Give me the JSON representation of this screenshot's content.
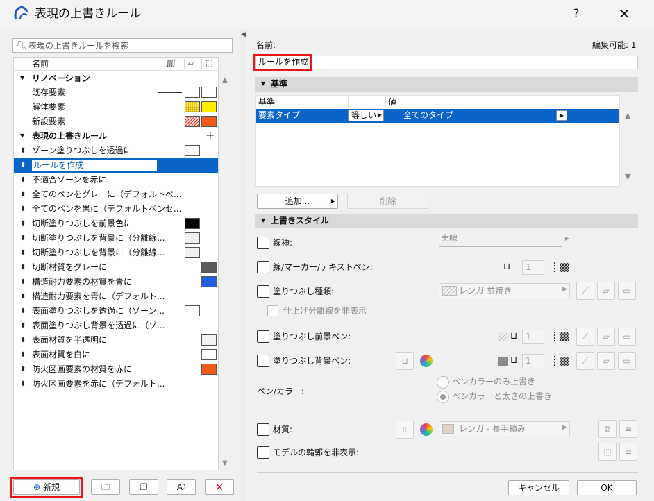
{
  "window": {
    "title": "表現の上書きルール",
    "help": "?",
    "close": "✕"
  },
  "search": {
    "placeholder": "表現の上書きルールを検索"
  },
  "list": {
    "header": {
      "name": "名前"
    },
    "groups": [
      {
        "label": "リノベーション",
        "items": [
          {
            "label": "既存要素"
          },
          {
            "label": "解体要素"
          },
          {
            "label": "新設要素"
          }
        ]
      },
      {
        "label": "表現の上書きルール",
        "add": "+",
        "items": [
          {
            "label": "ゾーン塗りつぶしを透過に"
          },
          {
            "label": "ルールを作成",
            "selected": true
          },
          {
            "label": "不適合ゾーンを赤に"
          },
          {
            "label": "全てのペンをグレーに（デフォルトペ..."
          },
          {
            "label": "全てのペンを黒に（デフォルトペンセ..."
          },
          {
            "label": "切断塗りつぶしを前景色に"
          },
          {
            "label": "切断塗りつぶしを背景に（分離線..."
          },
          {
            "label": "切断塗りつぶしを背景に（分離線..."
          },
          {
            "label": "切断材質をグレーに"
          },
          {
            "label": "構造耐力要素の材質を青に"
          },
          {
            "label": "構造耐力要素を青に（デフォルト..."
          },
          {
            "label": "表面塗りつぶしを透過に（ゾーン..."
          },
          {
            "label": "表面塗りつぶし背景を透過に（ゾ..."
          },
          {
            "label": "表面材質を半透明に"
          },
          {
            "label": "表面材質を白に"
          },
          {
            "label": "防火区画要素の材質を赤に"
          },
          {
            "label": "防火区画要素を赤に（デフォルト..."
          }
        ]
      }
    ]
  },
  "bottom_buttons": {
    "new": "新規"
  },
  "colors": {
    "selection": "#0a64c8",
    "highlight_box": "#e8141a",
    "yellow": "#ffee00",
    "orange": "#f05a1c",
    "blue": "#1f5fe0",
    "dark_grey": "#5a5a5a",
    "black": "#000000"
  },
  "detail": {
    "name_label": "名前:",
    "editable_label": "編集可能: 1",
    "name_value": "ルールを作成",
    "criteria": {
      "section": "基準",
      "col_criterion": "基準",
      "col_value": "値",
      "row": {
        "criterion": "要素タイプ",
        "operator": "等しい",
        "value": "全てのタイプ"
      },
      "add_button": "追加...",
      "delete_button": "削除"
    },
    "style": {
      "section": "上書きスタイル",
      "line_type": "線種:",
      "line_type_value": "実線",
      "line_marker_pen": "線/マーカー/テキストペン:",
      "pen_number": "1",
      "fill_type": "塗りつぶし種類:",
      "fill_type_value": "レンガ-並焼き",
      "hide_separator": "仕上げ分離線を非表示",
      "fill_fg_pen": "塗りつぶし前景ペン:",
      "fill_fg_pen_number": "1",
      "fill_bg_pen": "塗りつぶし背景ペン:",
      "fill_bg_pen_number": "1",
      "pen_color": "ペン/カラー:",
      "radio_color_only": "ペンカラーのみ上書き",
      "radio_color_weight": "ペンカラーと太さの上書き",
      "material": "材質:",
      "material_value": "レンガ - 長手積み",
      "hide_model_contour": "モデルの輪郭を非表示:"
    },
    "cancel": "キャンセル",
    "ok": "OK"
  }
}
